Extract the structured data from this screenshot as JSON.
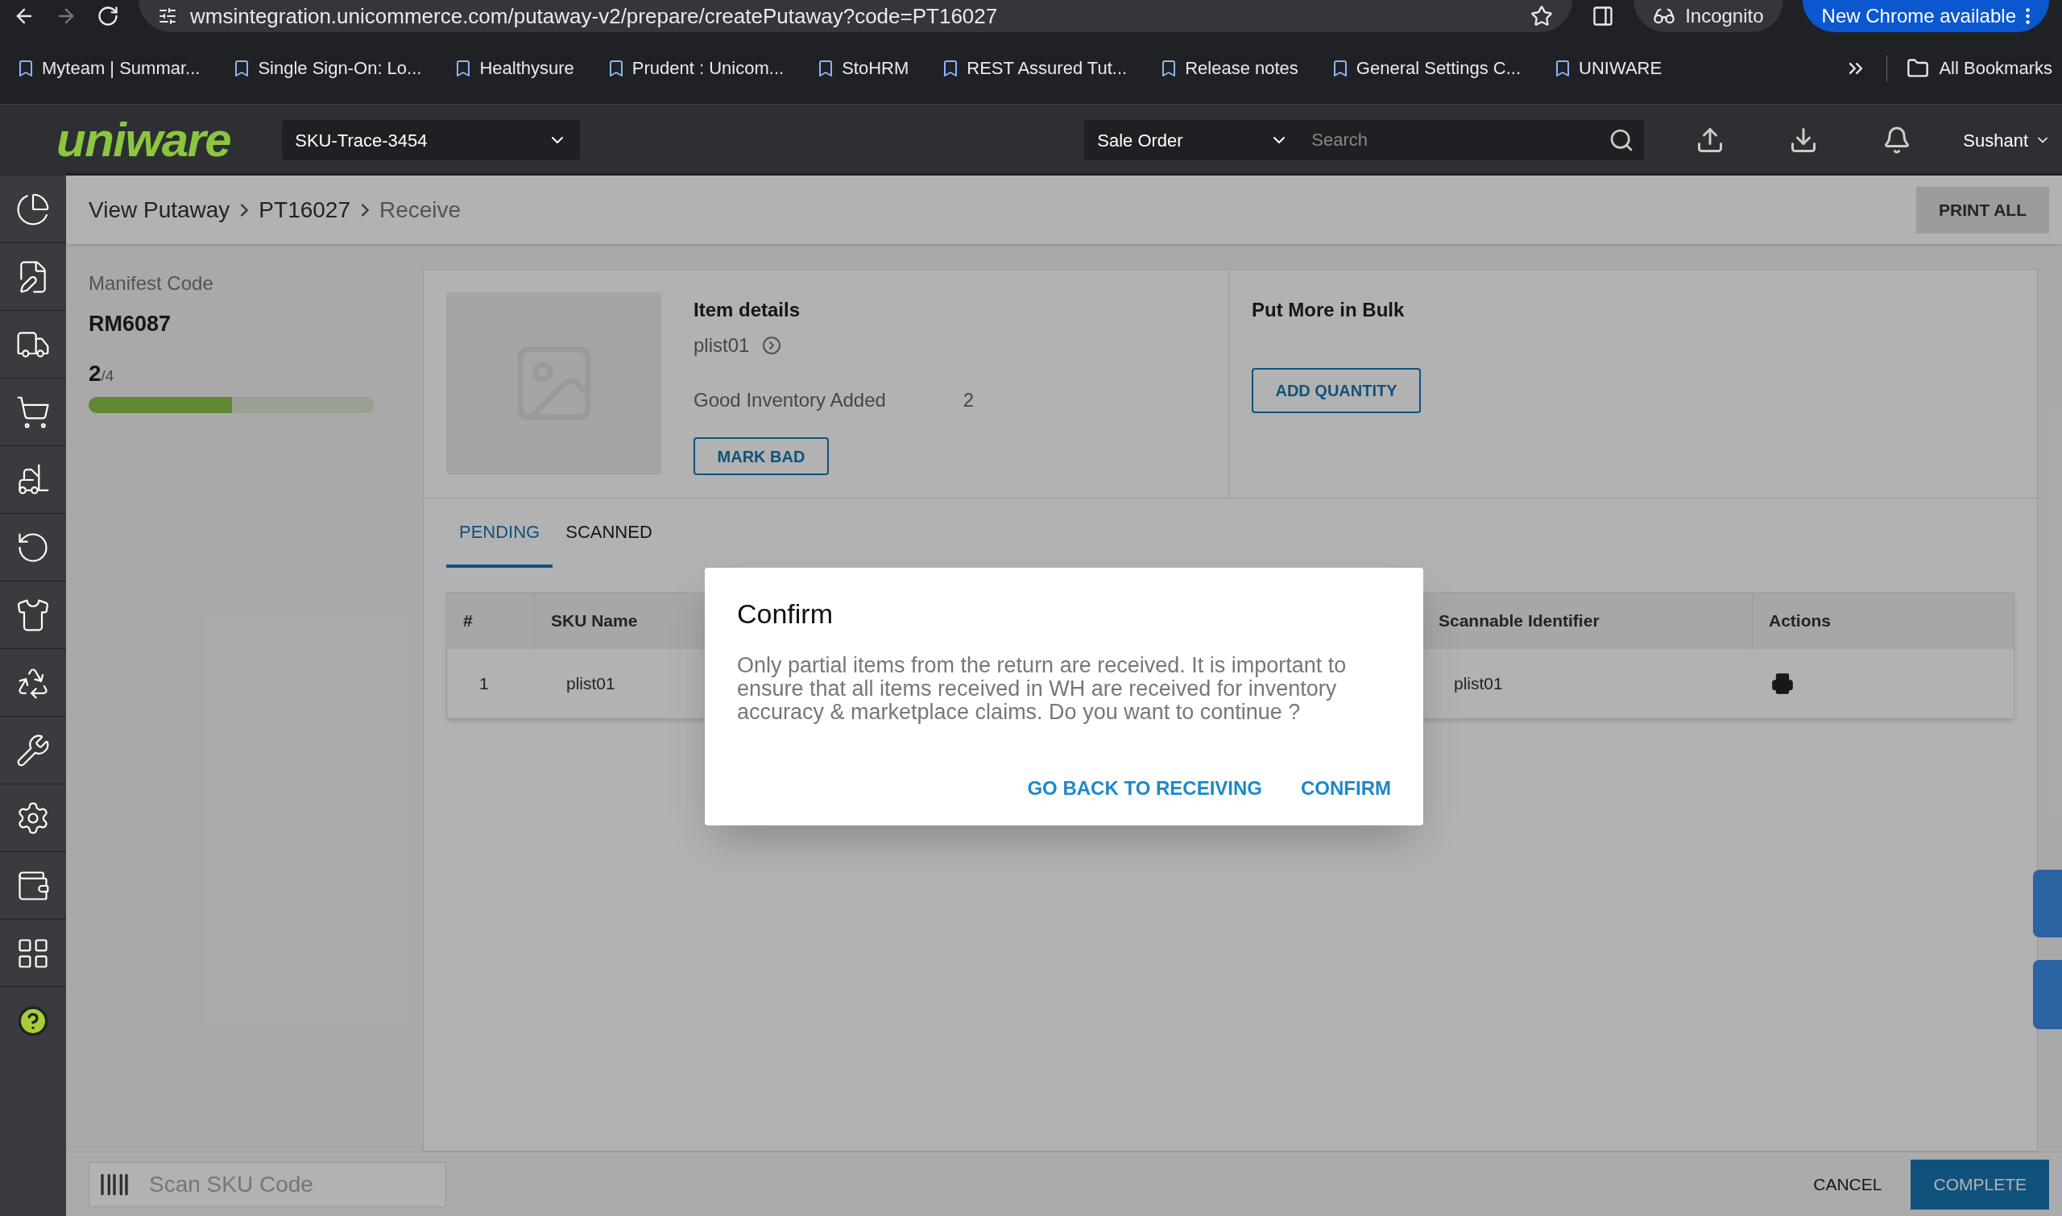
{
  "browser": {
    "url": "wmsintegration.unicommerce.com/putaway-v2/prepare/createPutaway?code=PT16027",
    "incognito": "Incognito",
    "update": "New Chrome available",
    "bookmarks": [
      "Myteam | Summar...",
      "Single Sign-On: Lo...",
      "Healthysure",
      "Prudent : Unicom...",
      "StoHRM",
      "REST Assured Tut...",
      "Release notes",
      "General Settings C...",
      "UNIWARE"
    ],
    "all_bookmarks": "All Bookmarks"
  },
  "header": {
    "logo": "uniware",
    "sku_select": "SKU-Trace-3454",
    "type_select": "Sale Order",
    "search": {
      "placeholder": "Search"
    },
    "user": "Sushant"
  },
  "breadcrumb": [
    "View Putaway",
    "PT16027",
    "Receive"
  ],
  "print_all": "PRINT ALL",
  "manifest": {
    "label": "Manifest Code",
    "code": "RM6087",
    "count": "2",
    "total": "/4",
    "level": 0.5
  },
  "item": {
    "title": "Item details",
    "sku": "plist01",
    "good_label": "Good Inventory Added",
    "good_value": "2",
    "mark_bad": "MARK BAD"
  },
  "bulk": {
    "title": "Put More in Bulk",
    "button": "ADD QUANTITY"
  },
  "tabs": [
    {
      "label": "PENDING",
      "selected": true
    },
    {
      "label": "SCANNED",
      "selected": false
    }
  ],
  "table": {
    "columns": [
      "#",
      "SKU Name",
      "Scannable Identifier",
      "Actions"
    ],
    "rows": [
      {
        "cells": [
          "1",
          "plist01",
          "plist01"
        ]
      }
    ]
  },
  "bottom": {
    "scan": {
      "placeholder": "Scan SKU Code"
    },
    "cancel": "CANCEL",
    "complete": "COMPLETE"
  },
  "dialog": {
    "title": "Confirm",
    "message": "Only partial items from the return are received. It is important to ensure that all items received in WH are received for inventory accuracy & marketplace claims. Do you want to continue ?",
    "buttons": [
      "GO BACK TO RECEIVING",
      "CONFIRM"
    ]
  }
}
